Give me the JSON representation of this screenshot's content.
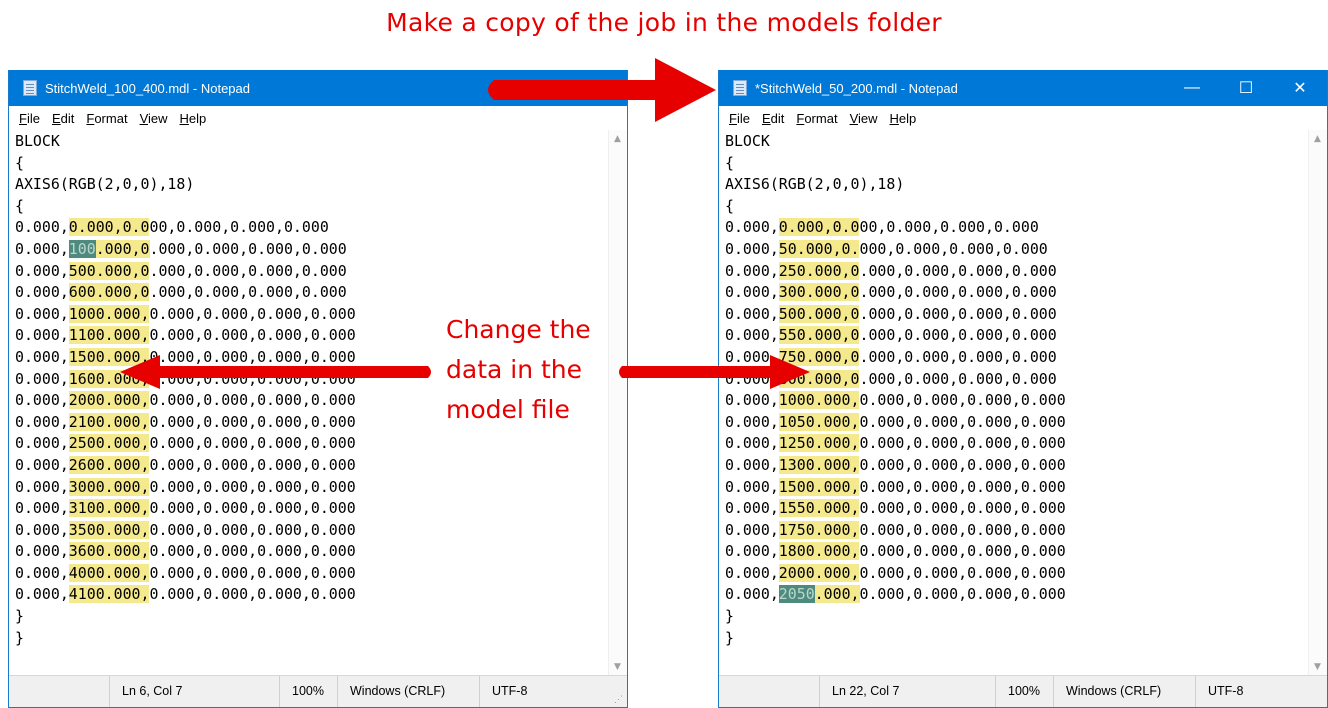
{
  "headline": "Make a copy of the job in the models folder",
  "annotation": {
    "line1": "Change the",
    "line2": "data in the",
    "line3": "model file"
  },
  "colors": {
    "annotation_red": "#e60000",
    "titlebar_blue": "#0078d7",
    "highlight_yellow": "#f5e98d",
    "selection_green": "#4f8a7e"
  },
  "menu": {
    "file": "File",
    "edit": "Edit",
    "format": "Format",
    "view": "View",
    "help": "Help"
  },
  "window_left": {
    "title": "StitchWeld_100_400.mdl - Notepad",
    "header_lines": [
      "BLOCK",
      "{",
      "AXIS6(RGB(2,0,0),18)",
      "{"
    ],
    "footer_lines": [
      "}",
      "}"
    ],
    "rows": [
      {
        "a": "0.000,",
        "b": "0.000,0.0",
        "c": "00,0.000,0.000,0.000"
      },
      {
        "a": "0.000,",
        "s": "100",
        "b": ".000,0",
        "c": ".000,0.000,0.000,0.000"
      },
      {
        "a": "0.000,",
        "b": "500.000,0",
        "c": ".000,0.000,0.000,0.000"
      },
      {
        "a": "0.000,",
        "b": "600.000,0",
        "c": ".000,0.000,0.000,0.000"
      },
      {
        "a": "0.000,",
        "b": "1000.000,",
        "c": "0.000,0.000,0.000,0.000"
      },
      {
        "a": "0.000,",
        "b": "1100.000,",
        "c": "0.000,0.000,0.000,0.000"
      },
      {
        "a": "0.000,",
        "b": "1500.000,",
        "c": "0.000,0.000,0.000,0.000"
      },
      {
        "a": "0.000,",
        "b": "1600.000,",
        "c": "0.000,0.000,0.000,0.000"
      },
      {
        "a": "0.000,",
        "b": "2000.000,",
        "c": "0.000,0.000,0.000,0.000"
      },
      {
        "a": "0.000,",
        "b": "2100.000,",
        "c": "0.000,0.000,0.000,0.000"
      },
      {
        "a": "0.000,",
        "b": "2500.000,",
        "c": "0.000,0.000,0.000,0.000"
      },
      {
        "a": "0.000,",
        "b": "2600.000,",
        "c": "0.000,0.000,0.000,0.000"
      },
      {
        "a": "0.000,",
        "b": "3000.000,",
        "c": "0.000,0.000,0.000,0.000"
      },
      {
        "a": "0.000,",
        "b": "3100.000,",
        "c": "0.000,0.000,0.000,0.000"
      },
      {
        "a": "0.000,",
        "b": "3500.000,",
        "c": "0.000,0.000,0.000,0.000"
      },
      {
        "a": "0.000,",
        "b": "3600.000,",
        "c": "0.000,0.000,0.000,0.000"
      },
      {
        "a": "0.000,",
        "b": "4000.000,",
        "c": "0.000,0.000,0.000,0.000"
      },
      {
        "a": "0.000,",
        "b": "4100.000,",
        "c": "0.000,0.000,0.000,0.000"
      }
    ],
    "status": {
      "position": "Ln 6, Col 7",
      "zoom": "100%",
      "line_ending": "Windows (CRLF)",
      "encoding": "UTF-8"
    }
  },
  "window_right": {
    "title": "*StitchWeld_50_200.mdl - Notepad",
    "header_lines": [
      "BLOCK",
      "{",
      "AXIS6(RGB(2,0,0),18)",
      "{"
    ],
    "footer_lines": [
      "}",
      "}"
    ],
    "rows": [
      {
        "a": "0.000,",
        "b": "0.000,0.0",
        "c": "00,0.000,0.000,0.000"
      },
      {
        "a": "0.000,",
        "b": "50.000,0.",
        "c": "000,0.000,0.000,0.000"
      },
      {
        "a": "0.000,",
        "b": "250.000,0",
        "c": ".000,0.000,0.000,0.000"
      },
      {
        "a": "0.000,",
        "b": "300.000,0",
        "c": ".000,0.000,0.000,0.000"
      },
      {
        "a": "0.000,",
        "b": "500.000,0",
        "c": ".000,0.000,0.000,0.000"
      },
      {
        "a": "0.000,",
        "b": "550.000,0",
        "c": ".000,0.000,0.000,0.000"
      },
      {
        "a": "0.000,",
        "b": "750.000,0",
        "c": ".000,0.000,0.000,0.000"
      },
      {
        "a": "0.000,",
        "b": "800.000,0",
        "c": ".000,0.000,0.000,0.000"
      },
      {
        "a": "0.000,",
        "b": "1000.000,",
        "c": "0.000,0.000,0.000,0.000"
      },
      {
        "a": "0.000,",
        "b": "1050.000,",
        "c": "0.000,0.000,0.000,0.000"
      },
      {
        "a": "0.000,",
        "b": "1250.000,",
        "c": "0.000,0.000,0.000,0.000"
      },
      {
        "a": "0.000,",
        "b": "1300.000,",
        "c": "0.000,0.000,0.000,0.000"
      },
      {
        "a": "0.000,",
        "b": "1500.000,",
        "c": "0.000,0.000,0.000,0.000"
      },
      {
        "a": "0.000,",
        "b": "1550.000,",
        "c": "0.000,0.000,0.000,0.000"
      },
      {
        "a": "0.000,",
        "b": "1750.000,",
        "c": "0.000,0.000,0.000,0.000"
      },
      {
        "a": "0.000,",
        "b": "1800.000,",
        "c": "0.000,0.000,0.000,0.000"
      },
      {
        "a": "0.000,",
        "b": "2000.000,",
        "c": "0.000,0.000,0.000,0.000"
      },
      {
        "a": "0.000,",
        "s": "2050",
        "b": ".000,",
        "c": "0.000,0.000,0.000,0.000"
      }
    ],
    "window_buttons": {
      "minimize": "—",
      "maximize": "☐",
      "close": "✕"
    },
    "status": {
      "position": "Ln 22, Col 7",
      "zoom": "100%",
      "line_ending": "Windows (CRLF)",
      "encoding": "UTF-8"
    }
  }
}
